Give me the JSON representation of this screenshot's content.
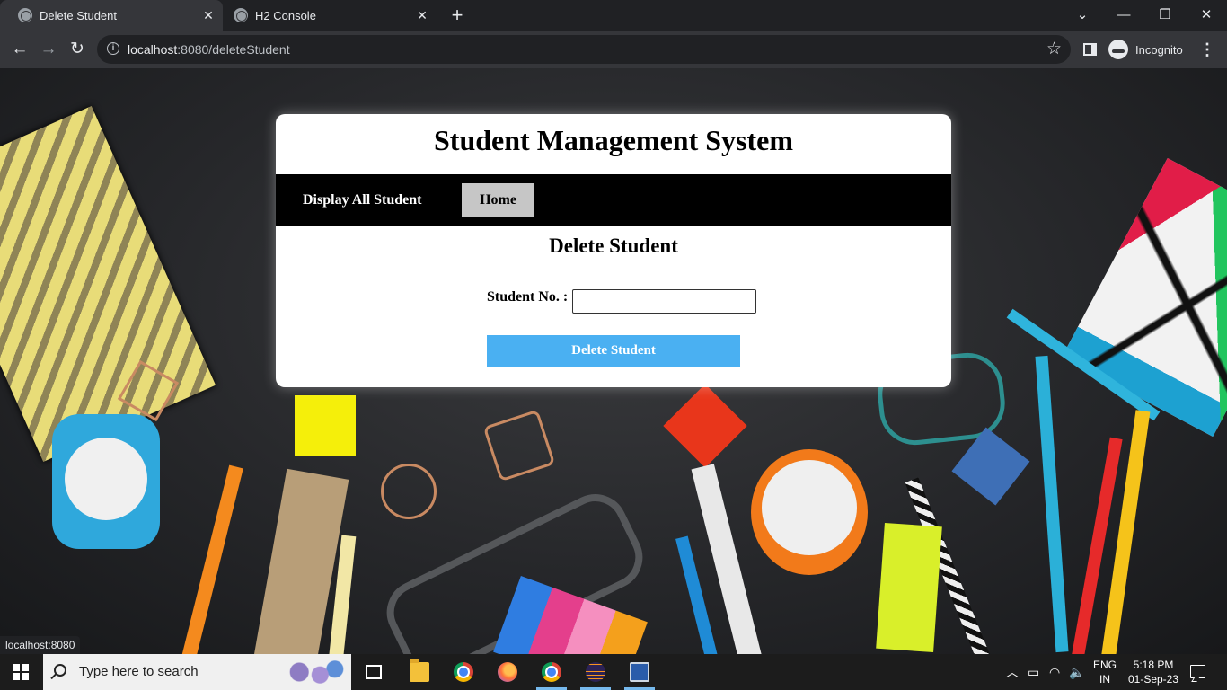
{
  "browser": {
    "tabs": [
      {
        "title": "Delete Student",
        "active": true
      },
      {
        "title": "H2 Console",
        "active": false
      }
    ],
    "address": {
      "host": "localhost",
      "path": ":8080/deleteStudent"
    },
    "profile_label": "Incognito",
    "status_url": "localhost:8080"
  },
  "page": {
    "title": "Student Management System",
    "nav": {
      "display_all": "Display All Student",
      "home": "Home"
    },
    "heading": "Delete Student",
    "form": {
      "student_no_label": "Student No. :",
      "student_no_value": "",
      "submit_label": "Delete Student"
    }
  },
  "taskbar": {
    "search_placeholder": "Type here to search",
    "apps": [
      "task-view",
      "file-explorer",
      "chrome",
      "firefox",
      "chrome-incognito",
      "eclipse",
      "remote-desktop"
    ],
    "language": {
      "line1": "ENG",
      "line2": "IN"
    },
    "time": "5:18 PM",
    "date": "01-Sep-23"
  },
  "colors": {
    "accent_button": "#4ab0f2",
    "nav_bar": "#000000",
    "home_button": "#c6c6c6"
  }
}
